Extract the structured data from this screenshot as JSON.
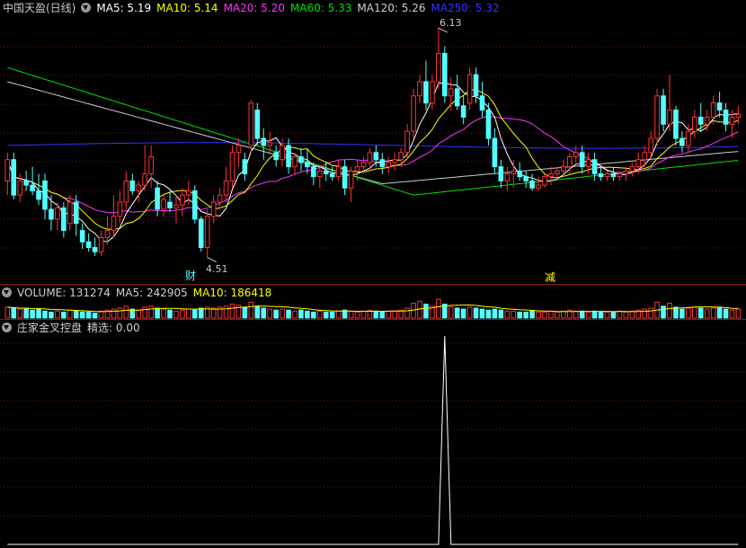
{
  "main": {
    "title": "中国天盈(日线)",
    "ma_items": [
      {
        "label": "MA5: 5.19",
        "color": "#ffffff"
      },
      {
        "label": "MA10: 5.14",
        "color": "#ffff00"
      },
      {
        "label": "MA20: 5.20",
        "color": "#ff33ff"
      },
      {
        "label": "MA60: 5.33",
        "color": "#00e000"
      },
      {
        "label": "MA120: 5.26",
        "color": "#cccccc"
      },
      {
        "label": "MA250: 5.32",
        "color": "#3333ff"
      }
    ],
    "high_label": "6.13",
    "low_label": "4.51",
    "marker_cai": "财",
    "marker_jian": "减"
  },
  "volume": {
    "items": [
      {
        "label": "VOLUME: 131274",
        "color": "#d0d0d0"
      },
      {
        "label": "MA5: 242905",
        "color": "#d0d0d0"
      },
      {
        "label": "MA10: 186418",
        "color": "#ffff00"
      }
    ]
  },
  "indicator": {
    "name": "庄家金叉控盘",
    "value_label": "精选: 0.00"
  },
  "colors": {
    "up": "#ff3232",
    "down": "#54ffff",
    "grid": "#7a1010",
    "ma5": "#ffffff",
    "ma10": "#ffff00",
    "ma20": "#ff33ff",
    "ma60": "#00e000",
    "ma120": "#cccccc",
    "ma250": "#3333ff"
  },
  "chart_data": {
    "type": "candlestick",
    "price_range": [
      4.45,
      6.2
    ],
    "candles": [
      [
        5.05,
        5.25,
        4.95,
        5.2
      ],
      [
        5.2,
        5.25,
        4.92,
        4.95
      ],
      [
        4.95,
        5.1,
        4.9,
        5.05
      ],
      [
        5.05,
        5.12,
        4.98,
        5.02
      ],
      [
        5.02,
        5.15,
        4.95,
        4.98
      ],
      [
        4.98,
        5.1,
        4.88,
        4.92
      ],
      [
        5.05,
        5.1,
        4.78,
        4.85
      ],
      [
        4.85,
        4.95,
        4.7,
        4.78
      ],
      [
        4.78,
        4.9,
        4.7,
        4.86
      ],
      [
        4.86,
        4.9,
        4.65,
        4.7
      ],
      [
        4.75,
        4.95,
        4.7,
        4.9
      ],
      [
        4.9,
        4.95,
        4.66,
        4.75
      ],
      [
        4.7,
        4.75,
        4.57,
        4.62
      ],
      [
        4.62,
        4.68,
        4.55,
        4.58
      ],
      [
        4.58,
        4.65,
        4.52,
        4.55
      ],
      [
        4.55,
        4.7,
        4.52,
        4.65
      ],
      [
        4.65,
        4.8,
        4.6,
        4.7
      ],
      [
        4.7,
        4.95,
        4.65,
        4.8
      ],
      [
        4.8,
        4.98,
        4.75,
        4.9
      ],
      [
        4.9,
        5.12,
        4.85,
        5.05
      ],
      [
        5.05,
        5.1,
        4.95,
        4.98
      ],
      [
        4.98,
        5.05,
        4.9,
        5.02
      ],
      [
        5.02,
        5.3,
        4.98,
        5.1
      ],
      [
        5.1,
        5.3,
        5.0,
        5.22
      ],
      [
        5.0,
        5.05,
        4.8,
        4.85
      ],
      [
        4.85,
        4.95,
        4.8,
        4.92
      ],
      [
        4.9,
        4.98,
        4.83,
        4.86
      ],
      [
        4.86,
        4.95,
        4.75,
        4.88
      ],
      [
        4.88,
        5.0,
        4.8,
        4.95
      ],
      [
        4.95,
        5.05,
        4.88,
        4.98
      ],
      [
        4.98,
        5.02,
        4.75,
        4.78
      ],
      [
        4.78,
        4.8,
        4.55,
        4.58
      ],
      [
        4.58,
        4.85,
        4.51,
        4.8
      ],
      [
        4.8,
        4.95,
        4.75,
        4.9
      ],
      [
        4.9,
        5.0,
        4.85,
        4.95
      ],
      [
        4.95,
        5.15,
        4.9,
        5.05
      ],
      [
        5.05,
        5.3,
        5.0,
        5.25
      ],
      [
        5.25,
        5.35,
        5.15,
        5.3
      ],
      [
        5.2,
        5.25,
        5.05,
        5.1
      ],
      [
        5.3,
        5.62,
        5.25,
        5.6
      ],
      [
        5.55,
        5.6,
        5.3,
        5.35
      ],
      [
        5.35,
        5.42,
        5.2,
        5.3
      ],
      [
        5.3,
        5.4,
        5.25,
        5.32
      ],
      [
        5.25,
        5.3,
        5.15,
        5.2
      ],
      [
        5.2,
        5.35,
        5.15,
        5.3
      ],
      [
        5.3,
        5.35,
        5.1,
        5.15
      ],
      [
        5.15,
        5.25,
        5.1,
        5.22
      ],
      [
        5.22,
        5.28,
        5.12,
        5.18
      ],
      [
        5.18,
        5.28,
        5.1,
        5.15
      ],
      [
        5.15,
        5.18,
        5.02,
        5.08
      ],
      [
        5.08,
        5.15,
        5.0,
        5.12
      ],
      [
        5.12,
        5.18,
        5.05,
        5.1
      ],
      [
        5.1,
        5.15,
        5.05,
        5.08
      ],
      [
        5.08,
        5.2,
        5.05,
        5.15
      ],
      [
        5.15,
        5.2,
        4.95,
        5.0
      ],
      [
        5.0,
        5.15,
        4.9,
        5.12
      ],
      [
        5.12,
        5.2,
        5.05,
        5.15
      ],
      [
        5.15,
        5.22,
        5.1,
        5.18
      ],
      [
        5.18,
        5.28,
        5.12,
        5.25
      ],
      [
        5.25,
        5.3,
        5.15,
        5.2
      ],
      [
        5.2,
        5.25,
        5.1,
        5.15
      ],
      [
        5.15,
        5.22,
        5.1,
        5.18
      ],
      [
        5.18,
        5.25,
        5.12,
        5.2
      ],
      [
        5.2,
        5.28,
        5.15,
        5.25
      ],
      [
        5.25,
        5.45,
        5.2,
        5.4
      ],
      [
        5.4,
        5.7,
        5.35,
        5.65
      ],
      [
        5.65,
        5.8,
        5.6,
        5.75
      ],
      [
        5.75,
        5.9,
        5.55,
        5.6
      ],
      [
        5.6,
        5.8,
        5.55,
        5.75
      ],
      [
        5.75,
        6.13,
        5.7,
        5.95
      ],
      [
        5.95,
        6.0,
        5.6,
        5.65
      ],
      [
        5.65,
        5.78,
        5.55,
        5.7
      ],
      [
        5.7,
        5.8,
        5.55,
        5.58
      ],
      [
        5.58,
        5.65,
        5.45,
        5.5
      ],
      [
        5.6,
        5.85,
        5.55,
        5.8
      ],
      [
        5.8,
        5.85,
        5.6,
        5.65
      ],
      [
        5.65,
        5.75,
        5.5,
        5.55
      ],
      [
        5.55,
        5.6,
        5.3,
        5.35
      ],
      [
        5.35,
        5.42,
        5.1,
        5.15
      ],
      [
        5.15,
        5.2,
        5.0,
        5.05
      ],
      [
        5.05,
        5.15,
        4.98,
        5.1
      ],
      [
        5.1,
        5.2,
        5.0,
        5.12
      ],
      [
        5.12,
        5.18,
        5.05,
        5.08
      ],
      [
        5.08,
        5.12,
        5.0,
        5.05
      ],
      [
        5.05,
        5.1,
        4.98,
        5.0
      ],
      [
        5.0,
        5.08,
        4.98,
        5.02
      ],
      [
        5.02,
        5.1,
        5.0,
        5.08
      ],
      [
        5.08,
        5.15,
        5.02,
        5.1
      ],
      [
        5.1,
        5.15,
        5.05,
        5.12
      ],
      [
        5.12,
        5.2,
        5.08,
        5.15
      ],
      [
        5.15,
        5.25,
        5.1,
        5.22
      ],
      [
        5.22,
        5.3,
        5.15,
        5.25
      ],
      [
        5.25,
        5.3,
        5.1,
        5.15
      ],
      [
        5.15,
        5.25,
        5.1,
        5.2
      ],
      [
        5.2,
        5.25,
        5.05,
        5.1
      ],
      [
        5.1,
        5.15,
        5.05,
        5.08
      ],
      [
        5.08,
        5.12,
        5.05,
        5.1
      ],
      [
        5.1,
        5.15,
        5.05,
        5.08
      ],
      [
        5.08,
        5.12,
        5.05,
        5.1
      ],
      [
        5.1,
        5.15,
        5.05,
        5.12
      ],
      [
        5.12,
        5.18,
        5.08,
        5.15
      ],
      [
        5.15,
        5.25,
        5.1,
        5.2
      ],
      [
        5.2,
        5.3,
        5.15,
        5.25
      ],
      [
        5.25,
        5.4,
        5.2,
        5.35
      ],
      [
        5.35,
        5.7,
        5.3,
        5.65
      ],
      [
        5.65,
        5.7,
        5.4,
        5.45
      ],
      [
        5.45,
        5.8,
        5.4,
        5.55
      ],
      [
        5.55,
        5.58,
        5.3,
        5.35
      ],
      [
        5.35,
        5.4,
        5.25,
        5.3
      ],
      [
        5.3,
        5.45,
        5.25,
        5.4
      ],
      [
        5.4,
        5.55,
        5.35,
        5.5
      ],
      [
        5.5,
        5.6,
        5.4,
        5.45
      ],
      [
        5.45,
        5.55,
        5.4,
        5.5
      ],
      [
        5.5,
        5.65,
        5.45,
        5.6
      ],
      [
        5.6,
        5.68,
        5.5,
        5.55
      ],
      [
        5.55,
        5.6,
        5.4,
        5.45
      ],
      [
        5.45,
        5.55,
        5.35,
        5.5
      ],
      [
        5.5,
        5.58,
        5.45,
        5.52
      ]
    ],
    "volumes": [
      0.55,
      0.5,
      0.45,
      0.5,
      0.4,
      0.45,
      0.35,
      0.3,
      0.35,
      0.3,
      0.4,
      0.35,
      0.3,
      0.3,
      0.25,
      0.35,
      0.4,
      0.45,
      0.5,
      0.6,
      0.45,
      0.4,
      0.55,
      0.6,
      0.5,
      0.45,
      0.4,
      0.35,
      0.4,
      0.45,
      0.4,
      0.5,
      0.55,
      0.5,
      0.55,
      0.6,
      0.7,
      0.65,
      0.55,
      0.8,
      0.6,
      0.5,
      0.45,
      0.4,
      0.45,
      0.4,
      0.35,
      0.4,
      0.35,
      0.3,
      0.35,
      0.3,
      0.3,
      0.35,
      0.4,
      0.35,
      0.3,
      0.35,
      0.4,
      0.35,
      0.3,
      0.35,
      0.35,
      0.4,
      0.5,
      0.75,
      0.85,
      0.7,
      0.6,
      0.95,
      0.7,
      0.55,
      0.5,
      0.45,
      0.55,
      0.5,
      0.45,
      0.4,
      0.45,
      0.4,
      0.35,
      0.35,
      0.3,
      0.3,
      0.35,
      0.3,
      0.3,
      0.35,
      0.3,
      0.35,
      0.4,
      0.35,
      0.35,
      0.3,
      0.35,
      0.3,
      0.3,
      0.3,
      0.35,
      0.3,
      0.35,
      0.4,
      0.45,
      0.5,
      0.8,
      0.6,
      0.75,
      0.55,
      0.45,
      0.5,
      0.55,
      0.5,
      0.45,
      0.5,
      0.55,
      0.45,
      0.4,
      0.45
    ],
    "indicator": {
      "series_name": "精选",
      "peak_index": 70,
      "peak_value": 1.0,
      "baseline": 0.0
    }
  }
}
